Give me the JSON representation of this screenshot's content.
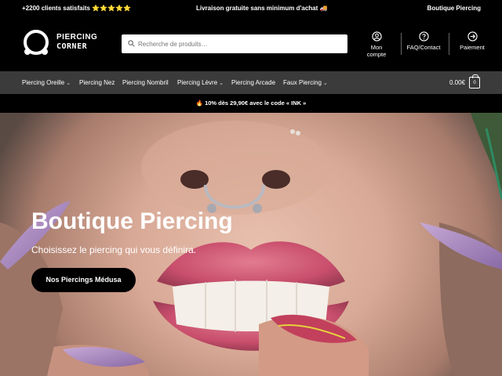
{
  "topbar": {
    "left": "+2200 clients satisfaits ⭐⭐⭐⭐⭐",
    "center": "Livraison gratuite sans minimum d'achat 🚚",
    "right": "Boutique Piercing"
  },
  "logo": {
    "line1": "PIERCING",
    "line2": "CORNER"
  },
  "search": {
    "placeholder": "Recherche de produits…",
    "value": ""
  },
  "header_links": [
    {
      "label": "Mon compte",
      "icon": "user-icon"
    },
    {
      "label": "FAQ/Contact",
      "icon": "question-icon"
    },
    {
      "label": "Paiement",
      "icon": "arrow-right-icon"
    }
  ],
  "nav": {
    "items": [
      {
        "label": "Piercing Oreille",
        "has_dropdown": true
      },
      {
        "label": "Piercing Nez",
        "has_dropdown": false
      },
      {
        "label": "Piercing Nombril",
        "has_dropdown": false
      },
      {
        "label": "Piercing Lèvre",
        "has_dropdown": true
      },
      {
        "label": "Piercing Arcade",
        "has_dropdown": false
      },
      {
        "label": "Faux Piercing",
        "has_dropdown": true
      }
    ],
    "cart_total": "0.00€",
    "cart_count": "0"
  },
  "promo": {
    "text": "🔥 10% dès 29,90€ avec le code « INK »"
  },
  "hero": {
    "title": "Boutique Piercing",
    "subtitle": "Choisissez le piercing qui vous définira.",
    "cta": "Nos Piercings Médusa"
  },
  "colors": {
    "nav_bg": "#3b3b3b",
    "bar_bg": "#000000",
    "text": "#ffffff"
  }
}
